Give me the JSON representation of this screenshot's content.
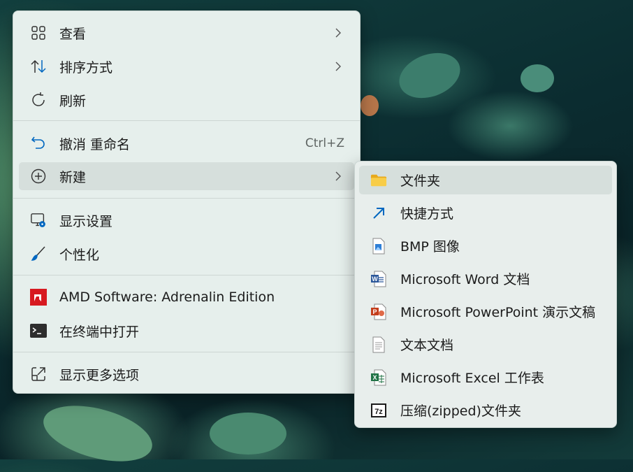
{
  "context_menu": {
    "items": [
      {
        "label": "查看",
        "icon": "grid-view-icon"
      },
      {
        "label": "排序方式",
        "icon": "sort-icon"
      },
      {
        "label": "刷新",
        "icon": "refresh-icon"
      },
      {
        "label": "撤消 重命名",
        "icon": "undo-icon",
        "shortcut": "Ctrl+Z"
      },
      {
        "label": "新建",
        "icon": "new-plus-icon"
      },
      {
        "label": "显示设置",
        "icon": "display-settings-icon"
      },
      {
        "label": "个性化",
        "icon": "personalize-brush-icon"
      },
      {
        "label": "AMD Software: Adrenalin Edition",
        "icon": "amd-logo-icon"
      },
      {
        "label": "在终端中打开",
        "icon": "terminal-icon"
      },
      {
        "label": "显示更多选项",
        "icon": "show-more-options-icon"
      }
    ]
  },
  "new_submenu": {
    "items": [
      {
        "label": "文件夹",
        "icon": "folder-icon"
      },
      {
        "label": "快捷方式",
        "icon": "shortcut-arrow-icon"
      },
      {
        "label": "BMP 图像",
        "icon": "bmp-image-icon"
      },
      {
        "label": "Microsoft Word 文档",
        "icon": "word-doc-icon"
      },
      {
        "label": "Microsoft PowerPoint 演示文稿",
        "icon": "powerpoint-doc-icon"
      },
      {
        "label": "文本文档",
        "icon": "text-doc-icon"
      },
      {
        "label": "Microsoft Excel 工作表",
        "icon": "excel-doc-icon"
      },
      {
        "label": "压缩(zipped)文件夹",
        "icon": "zip-7z-icon"
      }
    ]
  },
  "colors": {
    "accent": "#0067c0",
    "amd_red": "#d71920",
    "word": "#2b579a",
    "powerpoint": "#c43e1c",
    "excel": "#217346"
  }
}
